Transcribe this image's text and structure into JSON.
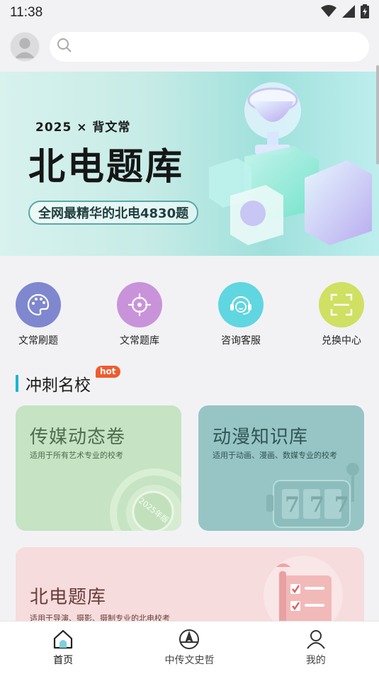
{
  "status_bar": {
    "time": "11:38",
    "icons": [
      "wifi-icon",
      "signal-icon",
      "battery-icon"
    ]
  },
  "header": {
    "search_placeholder": ""
  },
  "banner": {
    "top_line": "2025 × 背文常",
    "title": "北电题库",
    "subtitle": "全网最精华的北电4830题"
  },
  "quick_actions": [
    {
      "label": "文常刷题",
      "icon": "palette-icon",
      "color": "#7f87cf"
    },
    {
      "label": "文常题库",
      "icon": "target-icon",
      "color": "#c993da"
    },
    {
      "label": "咨询客服",
      "icon": "headset-icon",
      "color": "#5fd6e0"
    },
    {
      "label": "兑换中心",
      "icon": "scan-icon",
      "color": "#cfe063"
    }
  ],
  "section": {
    "title": "冲刺名校",
    "badge": "hot"
  },
  "cards": [
    {
      "title": "传媒动态卷",
      "desc": "适用于所有艺术专业的校考",
      "stamp": "2025年版",
      "bg": "#c6e3c4",
      "title_color": "#4e6c4e"
    },
    {
      "title": "动漫知识库",
      "desc": "适用于动画、漫画、数媒专业的校考",
      "slot": "777",
      "bg": "#97c4c4",
      "title_color": "#2f5556"
    },
    {
      "title": "北电题库",
      "desc": "适用于导演、摄影、摄制专业的北电校考",
      "bg": "#f6dcdc",
      "title_color": "#6b3a3a"
    }
  ],
  "bottom_nav": [
    {
      "label": "首页",
      "icon": "home-icon",
      "active": true
    },
    {
      "label": "中传文史哲",
      "icon": "compass-icon",
      "active": false
    },
    {
      "label": "我的",
      "icon": "user-icon",
      "active": false
    }
  ]
}
